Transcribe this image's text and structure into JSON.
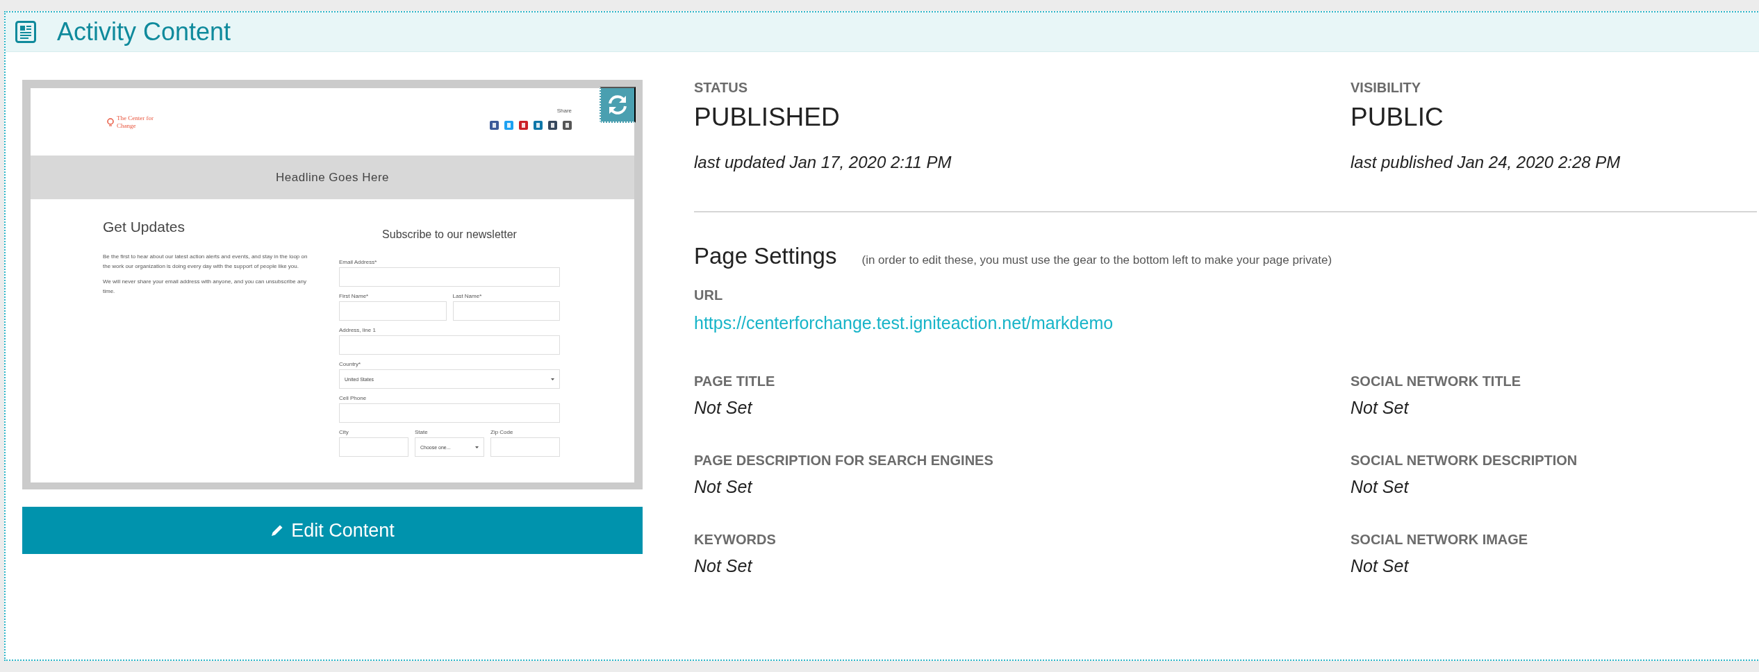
{
  "panel": {
    "title": "Activity Content"
  },
  "preview": {
    "logo_text": "The Center for Change",
    "share_label": "Share",
    "share_icons": [
      {
        "color": "#3b5998"
      },
      {
        "color": "#1da1f2"
      },
      {
        "color": "#cb2027"
      },
      {
        "color": "#0e76a8"
      },
      {
        "color": "#35465c"
      },
      {
        "color": "#555555"
      }
    ],
    "headline": "Headline Goes Here",
    "heading": "Get Updates",
    "paragraphs": [
      "Be the first to hear about our latest action alerts and events, and stay in the loop on the work our organization is doing every day with the support of people like you.",
      "We will never share your email address with anyone, and you can unsubscribe any time."
    ],
    "form_title": "Subscribe to our newsletter",
    "form_rows": [
      [
        {
          "label": "Email Address*",
          "kind": "text"
        }
      ],
      [
        {
          "label": "First Name*",
          "kind": "text"
        },
        {
          "label": "Last Name*",
          "kind": "text"
        }
      ],
      [
        {
          "label": "Address, line 1",
          "kind": "text"
        }
      ],
      [
        {
          "label": "Country*",
          "kind": "select",
          "value": "United States"
        }
      ],
      [
        {
          "label": "Cell Phone",
          "kind": "text"
        }
      ],
      [
        {
          "label": "City",
          "kind": "text"
        },
        {
          "label": "State",
          "kind": "select",
          "value": "Choose one..."
        },
        {
          "label": "Zip Code",
          "kind": "text"
        }
      ]
    ]
  },
  "edit_button": {
    "label": "Edit Content"
  },
  "status": [
    {
      "label": "STATUS",
      "value": "PUBLISHED",
      "note": "last updated Jan 17, 2020 2:11 PM"
    },
    {
      "label": "VISIBILITY",
      "value": "PUBLIC",
      "note": "last published Jan 24, 2020 2:28 PM"
    }
  ],
  "page_settings": {
    "title": "Page Settings",
    "hint": "(in order to edit these, you must use the gear to the bottom left to make your page private)",
    "url_label": "URL",
    "url": "https://centerforchange.test.igniteaction.net/markdemo"
  },
  "settings": [
    {
      "label": "PAGE TITLE",
      "value": "Not Set"
    },
    {
      "label": "SOCIAL NETWORK TITLE",
      "value": "Not Set"
    },
    {
      "label": "PAGE DESCRIPTION FOR SEARCH ENGINES",
      "value": "Not Set"
    },
    {
      "label": "SOCIAL NETWORK DESCRIPTION",
      "value": "Not Set"
    },
    {
      "label": "KEYWORDS",
      "value": "Not Set"
    },
    {
      "label": "SOCIAL NETWORK IMAGE",
      "value": "Not Set"
    }
  ]
}
